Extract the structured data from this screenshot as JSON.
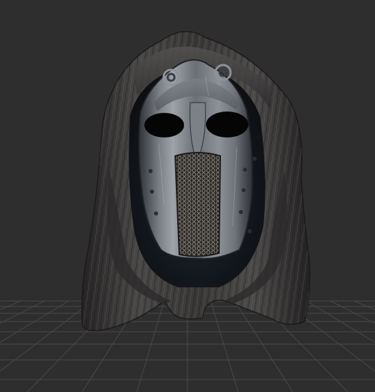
{
  "viewport": {
    "background": "#2e2e2e",
    "grid_color": "#4a4a4a"
  },
  "model": {
    "subject": "helmet-model",
    "hood_color": "#3a3838",
    "hood_highlight": "#6a6868",
    "faceplate_color": "#5c6066",
    "faceplate_highlight": "#a8adb3",
    "chainmail_color": "#4e4a44",
    "eye_color": "#050505"
  }
}
